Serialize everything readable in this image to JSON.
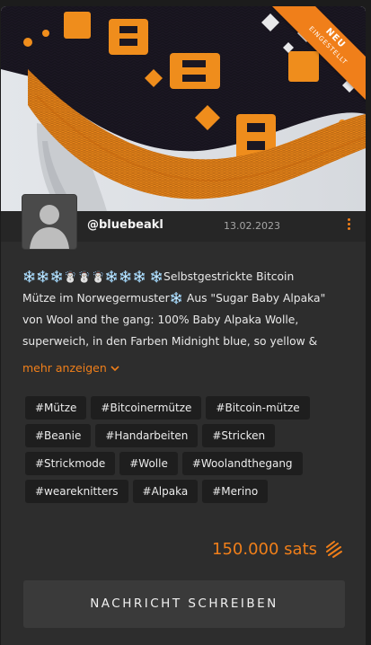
{
  "listing": {
    "badge": {
      "line1": "NEU",
      "line2": "EINGESTELLT"
    },
    "user": {
      "handle": "@bluebeakl",
      "date": "13.02.2023"
    },
    "description": {
      "line1": "❄️❄️❄️☃️☃️☃️❄️❄️❄️ ❄️Selbstgestrickte Bitcoin",
      "line2": "Mütze im Norwegermuster❄️ Aus \"Sugar Baby Alpaka\"",
      "line3": "von Wool and the gang: 100% Baby Alpaka Wolle,",
      "line4": "superweich, in den Farben Midnight blue, so yellow &"
    },
    "more_label": "mehr anzeigen",
    "tags": [
      "#Mütze",
      "#Bitcoinermütze",
      "#Bitcoin-mütze",
      "#Beanie",
      "#Handarbeiten",
      "#Stricken",
      "#Strickmode",
      "#Wolle",
      "#Woolandthegang",
      "#weareknitters",
      "#Alpaka",
      "#Merino"
    ],
    "price": "150.000 sats",
    "cta_label": "NACHRICHT SCHREIBEN",
    "icons": {
      "menu": "kebab-menu-icon",
      "more": "chevron-down-icon",
      "price": "sats-icon",
      "avatar": "default-avatar-icon"
    },
    "colors": {
      "accent": "#f07f1a",
      "card": "#2d2d2d",
      "tag_bg": "#1e1e1e",
      "button": "#3a3a3a"
    }
  }
}
